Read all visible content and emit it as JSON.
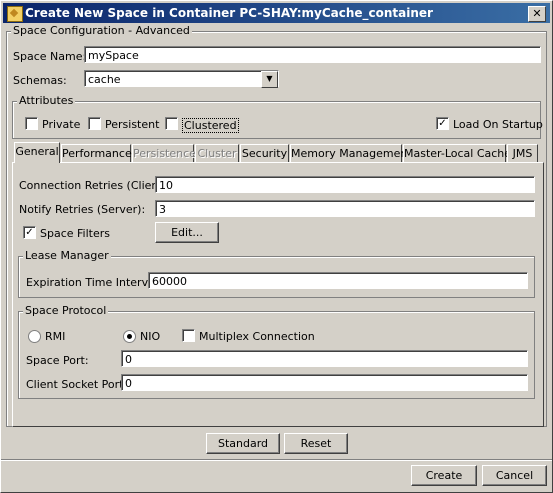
{
  "window": {
    "title": "Create New Space in Container PC-SHAY:myCache_container",
    "close_glyph": "✕"
  },
  "config_group": {
    "legend": "Space Configuration - Advanced"
  },
  "space_name": {
    "label": "Space Name:",
    "value": "mySpace"
  },
  "schemas": {
    "label": "Schemas:",
    "value": "cache"
  },
  "attributes": {
    "legend": "Attributes",
    "private": {
      "label": "Private",
      "checked": false
    },
    "persistent": {
      "label": "Persistent",
      "checked": false
    },
    "clustered": {
      "label": "Clustered",
      "checked": false
    },
    "load_on_startup": {
      "label": "Load On Startup",
      "checked": true
    }
  },
  "tabs": [
    {
      "label": "General",
      "state": "active"
    },
    {
      "label": "Performance",
      "state": "enabled"
    },
    {
      "label": "Persistence",
      "state": "disabled"
    },
    {
      "label": "Cluster",
      "state": "disabled"
    },
    {
      "label": "Security",
      "state": "enabled"
    },
    {
      "label": "Memory Management",
      "state": "enabled"
    },
    {
      "label": "Master-Local Cache",
      "state": "enabled"
    },
    {
      "label": "JMS",
      "state": "enabled"
    }
  ],
  "general": {
    "connection_retries": {
      "label": "Connection Retries (Client):",
      "value": "10"
    },
    "notify_retries": {
      "label": "Notify Retries (Server):",
      "value": "3"
    },
    "space_filters": {
      "label": "Space Filters",
      "checked": true
    },
    "edit_button": "Edit...",
    "lease_manager": {
      "legend": "Lease Manager",
      "expiration_label": "Expiration Time Interval:",
      "expiration_value": "60000"
    },
    "space_protocol": {
      "legend": "Space Protocol",
      "rmi_label": "RMI",
      "nio_label": "NIO",
      "selected": "NIO",
      "multiplex_label": "Multiplex Connection",
      "multiplex_checked": false,
      "space_port_label": "Space Port:",
      "space_port_value": "0",
      "client_socket_port_label": "Client Socket Port:",
      "client_socket_port_value": "0"
    }
  },
  "buttons": {
    "standard": "Standard",
    "reset": "Reset",
    "create": "Create",
    "cancel": "Cancel"
  },
  "glyphs": {
    "check": "✓",
    "dropdown": "▼"
  }
}
